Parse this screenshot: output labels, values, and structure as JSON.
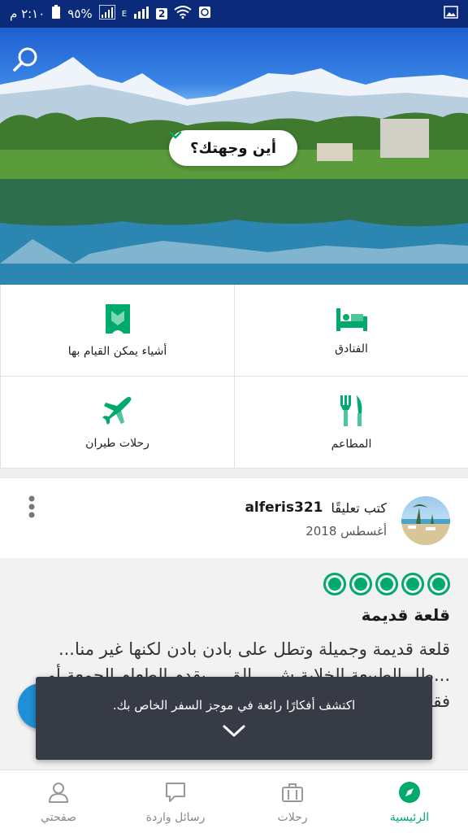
{
  "status_bar": {
    "time": "٢:١٠ م",
    "battery": "٩٥%",
    "sim_badge": "2",
    "network_letter": "E"
  },
  "hero": {
    "where_to": "أين وجهتك؟"
  },
  "categories": [
    {
      "label": "الفنادق",
      "icon": "bed-icon"
    },
    {
      "label": "أشياء يمكن القيام بها",
      "icon": "ticket-icon"
    },
    {
      "label": "المطاعم",
      "icon": "fork-knife-icon"
    },
    {
      "label": "رحلات طيران",
      "icon": "plane-icon"
    }
  ],
  "review": {
    "author": "alferis321",
    "action": "كتب تعليقًا",
    "date": "أغسطس 2018",
    "rating": 5,
    "title": "قلعة قديمة",
    "text": "قلعة قديمة وجميلة وتطل على بادن بادن لكنها غير منا... ...طل الطبيعة الخلابة ش... الق... يقدم الطعام الجمعة أو فقط في الحفلات"
  },
  "toast": {
    "message": "اكتشف أفكارًا رائعة في موجز السفر الخاص بك."
  },
  "bottom_nav": [
    {
      "label": "الرئيسية",
      "icon": "compass-icon",
      "active": true
    },
    {
      "label": "رحلات",
      "icon": "suitcase-icon",
      "active": false
    },
    {
      "label": "رسائل واردة",
      "icon": "chat-icon",
      "active": false
    },
    {
      "label": "صفحتي",
      "icon": "profile-icon",
      "active": false
    }
  ],
  "colors": {
    "brand_green": "#00aa6c",
    "status_bar": "#0c2a7a",
    "toast_bg": "#363b45"
  }
}
